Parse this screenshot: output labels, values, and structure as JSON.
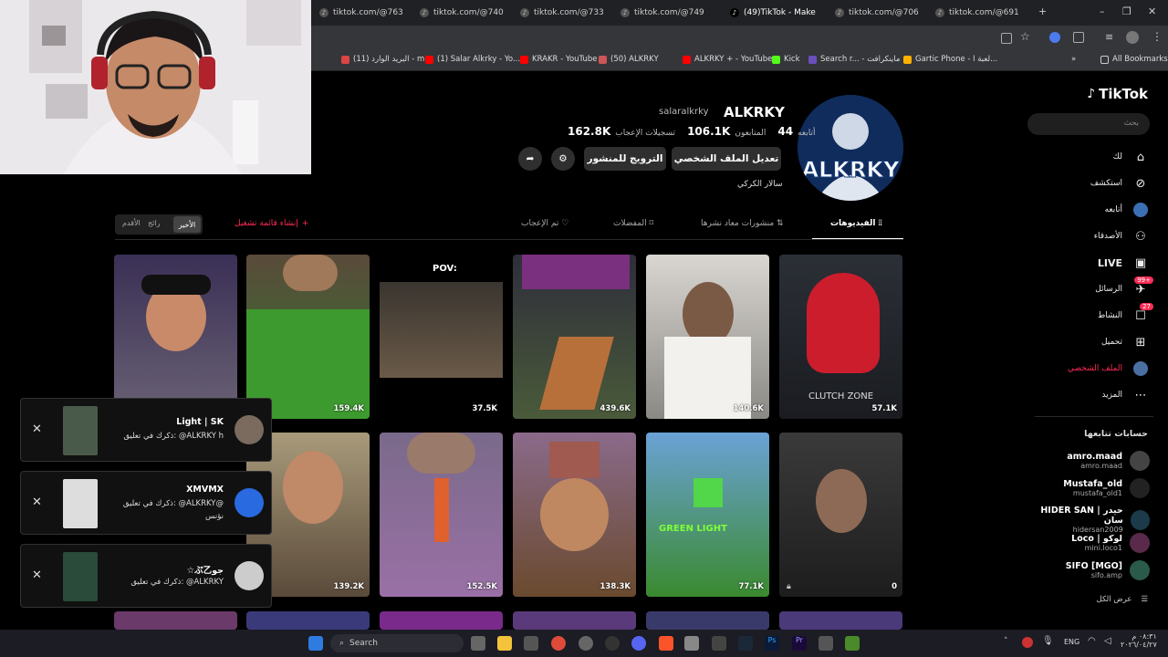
{
  "browser": {
    "tabs": [
      {
        "title": "tiktok.com/@763"
      },
      {
        "title": "tiktok.com/@740"
      },
      {
        "title": "tiktok.com/@733"
      },
      {
        "title": "tiktok.com/@749"
      },
      {
        "title": "(49)TikTok - Make"
      },
      {
        "title": "tiktok.com/@706"
      },
      {
        "title": "tiktok.com/@691"
      }
    ],
    "bookmarks": [
      "البريد الوارد (11) - m...",
      "(1) Salar Alkrky - Yo...",
      "KRAKR - YouTube",
      "(50) ALKRKY",
      "ALKRKY + - YouTube",
      "Kick",
      "Search r... - ماينكرافت",
      "Gartic Phone - لعبة ا...",
      "All Bookmarks"
    ]
  },
  "tiktok": {
    "logo": "TikTok",
    "search_placeholder": "بحث",
    "nav": [
      {
        "label": "لك"
      },
      {
        "label": "استكشف"
      },
      {
        "label": "أتابعه"
      },
      {
        "label": "الأصدقاء"
      },
      {
        "label": "LIVE"
      },
      {
        "label": "الرسائل",
        "badge": "99+"
      },
      {
        "label": "النشاط",
        "badge": "27"
      },
      {
        "label": "تحميل"
      },
      {
        "label": "الملف الشخصي"
      },
      {
        "label": "المزيد"
      }
    ],
    "following_title": "حسابات تتابعها",
    "following": [
      {
        "name": "amro.maad",
        "handle": "amro.maad"
      },
      {
        "name": "Mustafa_old",
        "handle": "mustafa_old1"
      },
      {
        "name": "HIDER SAN | حيدر سان",
        "handle": "hidersan2009"
      },
      {
        "name": "Loco | لوكو",
        "handle": "mini.loco1"
      },
      {
        "name": "SIFO [MGO]",
        "handle": "sifo.amp"
      }
    ],
    "see_all": "عرض الكل"
  },
  "profile": {
    "display_name": "ALKRKY",
    "username": "salaralkrky",
    "following_label": "أتابعه",
    "following_count": "44",
    "followers_label": "المتابعون",
    "followers_count": "106.1K",
    "likes_label": "تسجيلات الإعجاب",
    "likes_count": "162.8K",
    "bio": "سالار الكركي",
    "edit_button": "تعديل الملف الشخصي",
    "promote_button": "الترويج للمنشور",
    "tabs": [
      "الفيديوهات",
      "منشورات معاد نشرها",
      "المفضلات",
      "تم الإعجاب"
    ],
    "create_playlist": "إنشاء قائمة تشغيل",
    "sort_options": [
      "الأخير",
      "رائج",
      "الأقدم"
    ]
  },
  "videos": [
    {
      "views": "57.1K",
      "overlay": "CLUTCH ZONE"
    },
    {
      "views": "140.6K",
      "overlay": ""
    },
    {
      "views": "439.6K",
      "overlay": ""
    },
    {
      "views": "37.5K",
      "overlay": "POV:"
    },
    {
      "views": "159.4K",
      "overlay": ""
    },
    {
      "views": "",
      "overlay": ""
    },
    {
      "views": "0",
      "overlay": ""
    },
    {
      "views": "77.1K",
      "overlay": "GREEN LIGHT"
    },
    {
      "views": "138.3K",
      "overlay": ""
    },
    {
      "views": "152.5K",
      "overlay": ""
    },
    {
      "views": "139.2K",
      "overlay": ""
    }
  ],
  "notifications": [
    {
      "title": "Light | SK",
      "text": "ذكرك في تعليق: @ALKRKY h"
    },
    {
      "title": "XMVMX",
      "text": "ذكرك في تعليق: @ALKRKY@",
      "sub": "نؤنس"
    },
    {
      "title": "☆ぷ乙جو",
      "text": "ذكرك في تعليق: @ALKRKY"
    }
  ],
  "taskbar": {
    "search": "Search",
    "lang": "ENG",
    "time": "٠٨:٣١ م",
    "date": "٢٠٢٦/٠٤/٢٧"
  },
  "colors": {
    "accent": "#fe2c55",
    "background": "#000000"
  }
}
